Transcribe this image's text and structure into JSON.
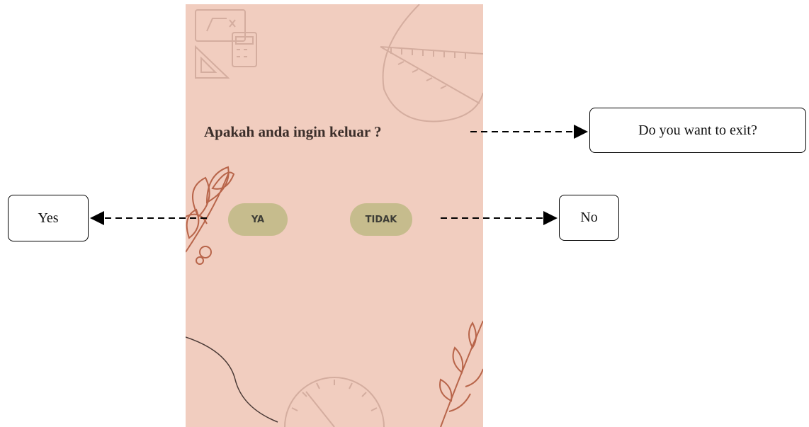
{
  "dialog": {
    "question": "Apakah anda ingin keluar ?",
    "yes_label": "YA",
    "no_label": "TIDAK"
  },
  "annotations": {
    "question_translation": "Do you want to exit?",
    "yes_translation": "Yes",
    "no_translation": "No"
  },
  "colors": {
    "background": "#f1cdbf",
    "button": "#c6bc8d",
    "leaf": "#b8654a"
  },
  "icons": [
    "math-tools-icon",
    "ruler-icon",
    "leaf-branch-icon",
    "protractor-icon"
  ]
}
